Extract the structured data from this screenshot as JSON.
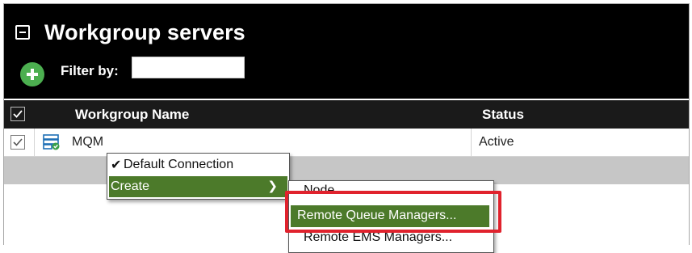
{
  "header": {
    "title": "Workgroup servers",
    "filter_label": "Filter by:",
    "filter_value": ""
  },
  "table": {
    "columns": [
      "Workgroup Name",
      "Status"
    ],
    "rows": [
      {
        "checked": true,
        "name": "MQM",
        "status": "Active"
      }
    ]
  },
  "context_menu": {
    "items": [
      {
        "label": "Default Connection",
        "checked": true
      },
      {
        "label": "Create",
        "has_submenu": true,
        "highlighted": true
      }
    ]
  },
  "submenu": {
    "items": [
      {
        "label": "Node"
      },
      {
        "label": "Remote Queue Managers...",
        "highlighted": true
      },
      {
        "label": "Remote EMS Managers..."
      }
    ]
  },
  "colors": {
    "header_bg": "#000000",
    "menu_highlight": "#4c7a2a",
    "add_button": "#4caf50",
    "callout_border": "#e0222d"
  },
  "icons": {
    "collapse": "minus-square-icon",
    "add": "plus-circle-icon",
    "server": "server-status-icon",
    "check": "checkmark-icon",
    "submenu_arrow": "chevron-right-icon"
  }
}
